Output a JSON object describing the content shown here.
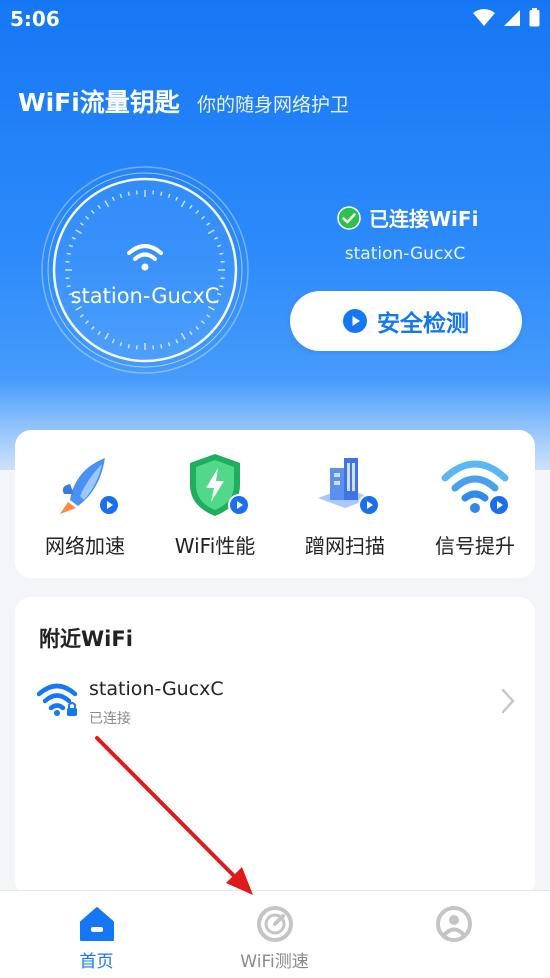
{
  "status_bar": {
    "time": "5:06"
  },
  "header": {
    "title": "WiFi流量钥匙",
    "subtitle": "你的随身网络护卫"
  },
  "dial": {
    "ssid": "station-GucxC"
  },
  "connection": {
    "status": "已连接WiFi",
    "ssid": "station-GucxC",
    "scan_button": "安全检测"
  },
  "tools": [
    {
      "label": "网络加速",
      "icon": "rocket-icon"
    },
    {
      "label": "WiFi性能",
      "icon": "shield-bolt-icon"
    },
    {
      "label": "蹭网扫描",
      "icon": "building-scan-icon"
    },
    {
      "label": "信号提升",
      "icon": "wifi-signal-icon"
    }
  ],
  "nearby": {
    "title": "附近WiFi",
    "items": [
      {
        "name": "station-GucxC",
        "status": "已连接"
      }
    ]
  },
  "bottom_nav": [
    {
      "label": "首页",
      "icon": "home-icon",
      "active": true
    },
    {
      "label": "WiFi测速",
      "icon": "speedometer-icon",
      "active": false
    },
    {
      "label": "",
      "icon": "profile-icon",
      "active": false
    }
  ],
  "colors": {
    "primary": "#1677f5",
    "annotation_arrow": "#e01a1a"
  }
}
